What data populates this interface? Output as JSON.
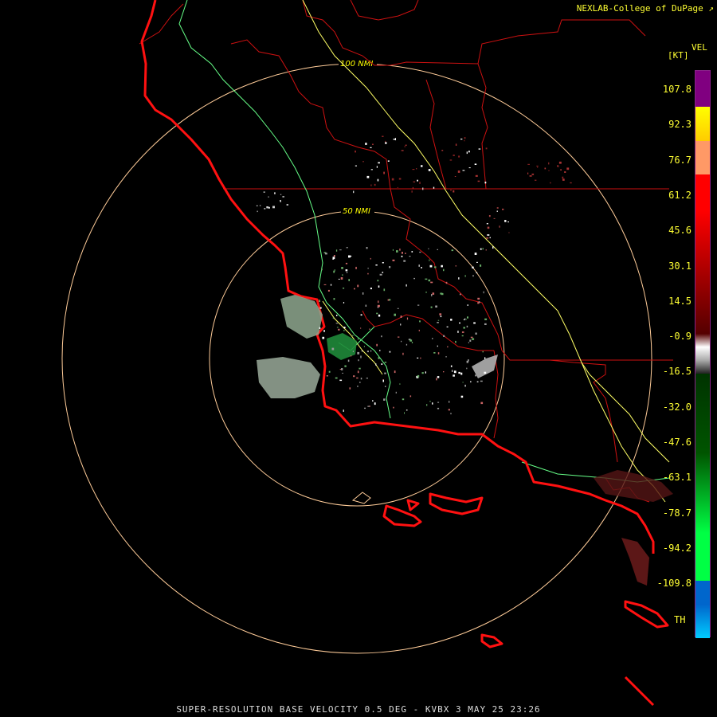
{
  "header": {
    "credit": "NEXLAB-College of DuPage",
    "credit_icon": "external-link-icon",
    "product": "VEL",
    "units": "[KT]"
  },
  "rings": [
    {
      "label": "100 NMI"
    },
    {
      "label": "50 NMI"
    }
  ],
  "scale": {
    "ticks": [
      "107.8",
      "92.3",
      "76.7",
      "61.2",
      "45.6",
      "30.1",
      "14.5",
      "-0.9",
      "-16.5",
      "-32.0",
      "-47.6",
      "-63.1",
      "-78.7",
      "-94.2",
      "-109.8"
    ],
    "th_label": "TH",
    "colors": {
      "purple": "#800080",
      "yellow": "#ffff00",
      "orange": "#ff9966",
      "red": "#ff0000",
      "darkred": "#550000",
      "gray": "#aaaaaa",
      "darkgreen": "#005500",
      "green": "#00ff44",
      "blue": "#0066cc",
      "cyan": "#00ccff"
    }
  },
  "map_colors": {
    "coastline": "#ff1111",
    "county": "#cc1111",
    "highway": "#ffff66",
    "river": "#66ff88",
    "ring": "#ffcc99"
  },
  "footer": "SUPER-RESOLUTION BASE VELOCITY 0.5 DEG - KVBX 3 MAY 25 23:26"
}
